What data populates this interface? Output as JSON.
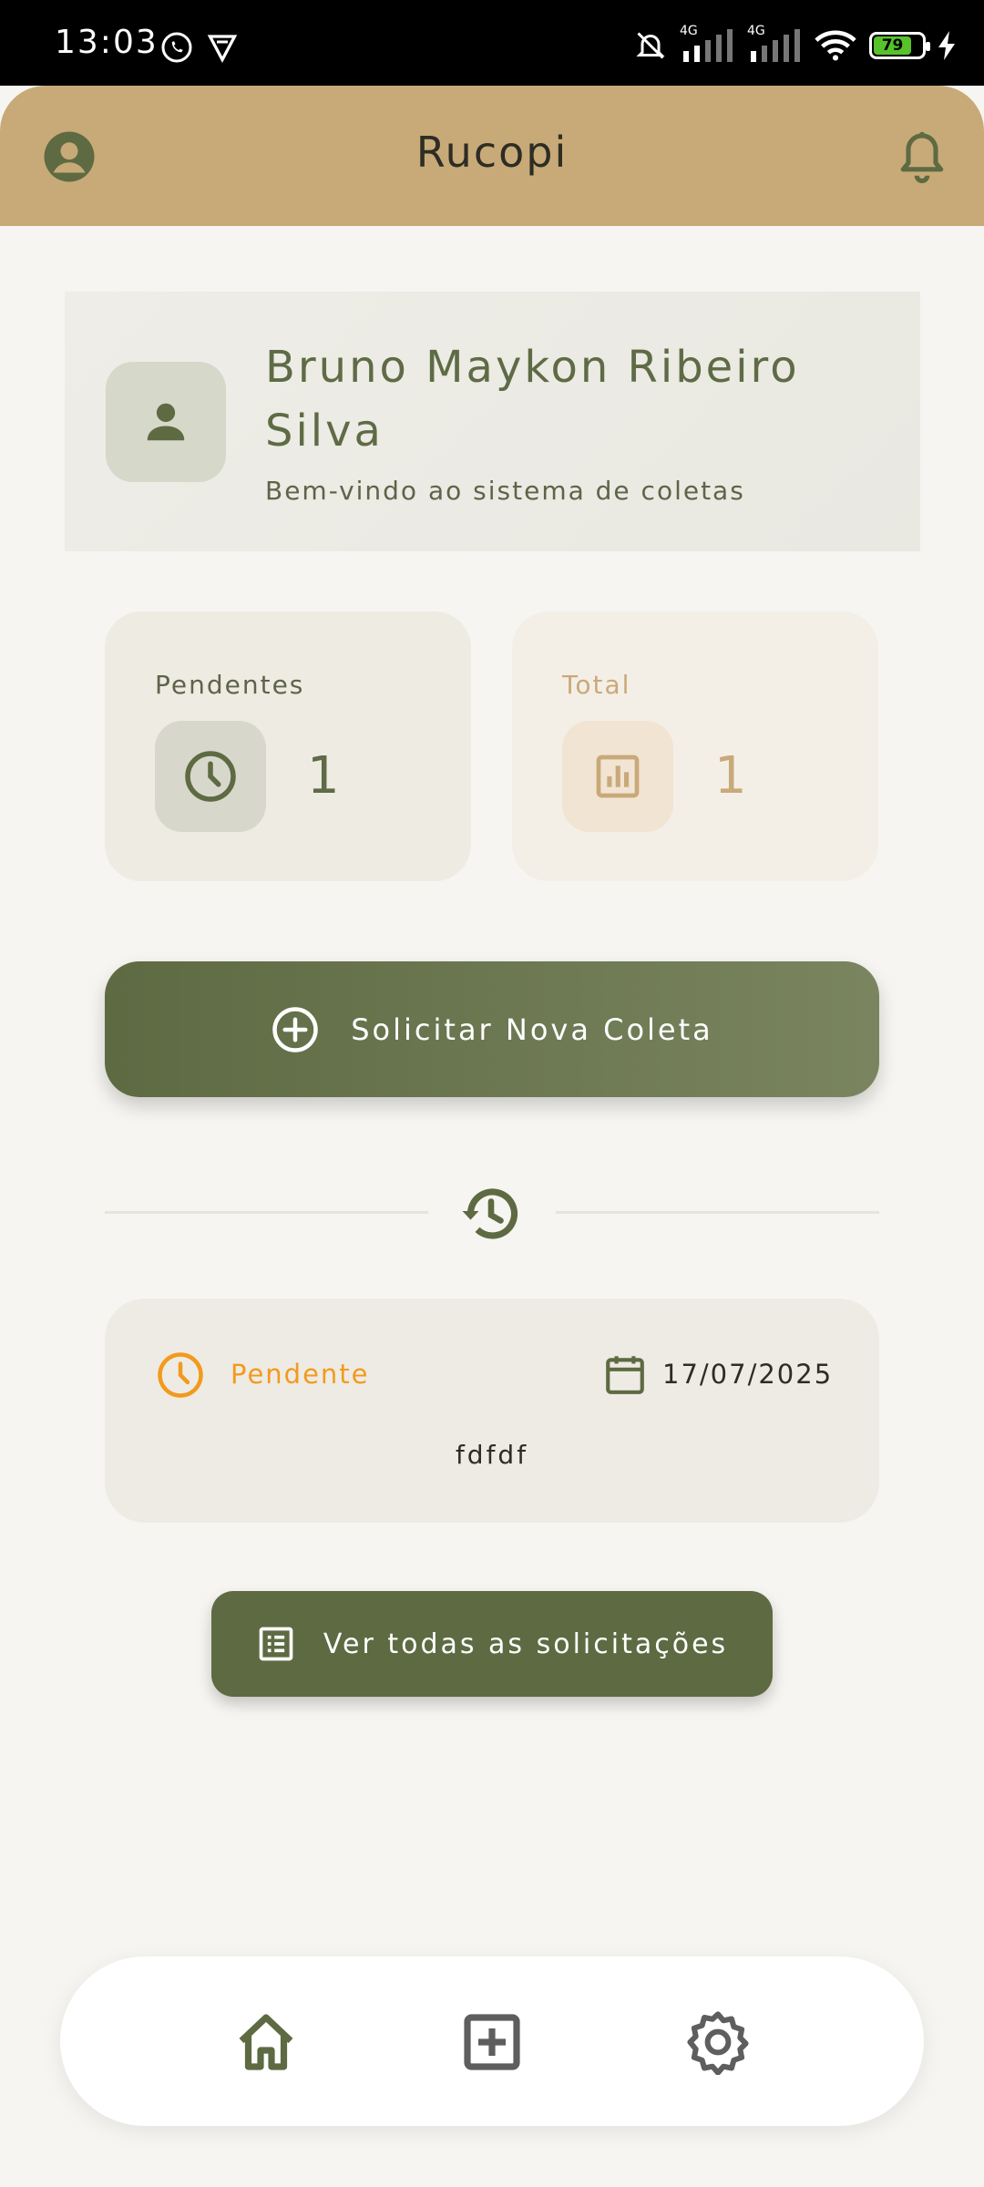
{
  "status_bar": {
    "time": "13:03",
    "network_1": "4G",
    "network_2": "4G",
    "battery": "79"
  },
  "header": {
    "title": "Rucopi",
    "profile_icon": "account-circle-icon",
    "bell_icon": "bell-icon"
  },
  "welcome": {
    "name": "Bruno Maykon Ribeiro Silva",
    "subtitle": "Bem-vindo ao sistema de coletas"
  },
  "stats": {
    "pending": {
      "label": "Pendentes",
      "value": "1",
      "icon": "clock-icon"
    },
    "total": {
      "label": "Total",
      "value": "1",
      "icon": "bar-chart-icon"
    }
  },
  "new_request_button": {
    "label": "Solicitar Nova Coleta",
    "icon": "add-circle-icon"
  },
  "history_icon": "history-icon",
  "requests": [
    {
      "status": "Pendente",
      "date": "17/07/2025",
      "description": "fdfdf"
    }
  ],
  "view_all_button": {
    "label": "Ver todas as solicitações",
    "icon": "list-icon"
  },
  "bottom_nav": [
    "home-icon",
    "add-box-icon",
    "settings-icon"
  ],
  "colors": {
    "header_bg": "#c8aa78",
    "primary": "#5e6a42",
    "pending_orange": "#f29a1e",
    "total_tan": "#c9a97a"
  }
}
